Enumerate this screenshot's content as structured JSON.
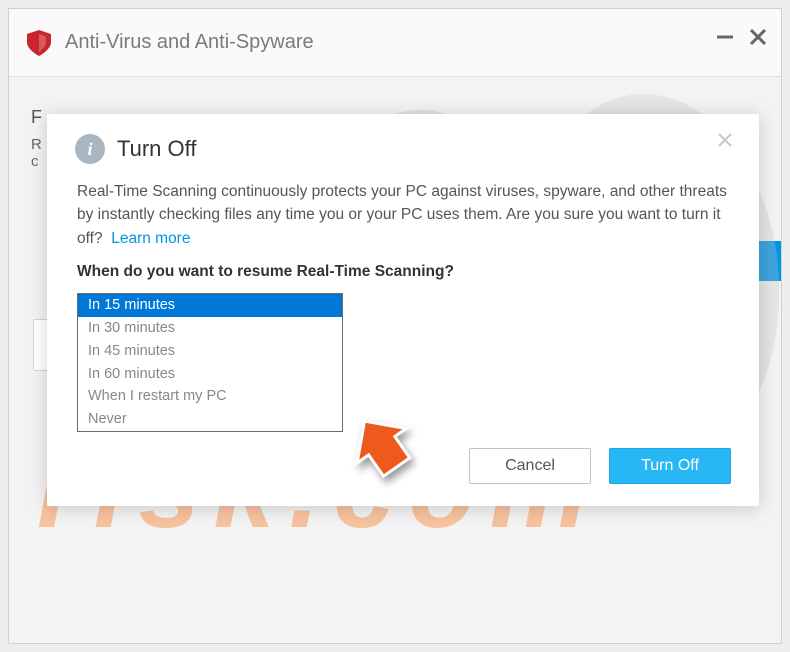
{
  "header": {
    "window_title": "Anti-Virus and Anti-Spyware"
  },
  "background_text": "R\nc",
  "modal": {
    "title": "Turn Off",
    "body": "Real-Time Scanning continuously protects your PC against viruses, spyware, and other threats by instantly checking files any time you or your PC uses them. Are you sure you want to turn it off?",
    "learn_more": "Learn more",
    "prompt": "When do you want to resume Real-Time Scanning?",
    "options": [
      "In 15 minutes",
      "In 30 minutes",
      "In 45 minutes",
      "In 60 minutes",
      "When I restart my PC",
      "Never"
    ],
    "selected_index": 0,
    "cancel_label": "Cancel",
    "confirm_label": "Turn Off"
  },
  "watermark_text": "risk.com"
}
